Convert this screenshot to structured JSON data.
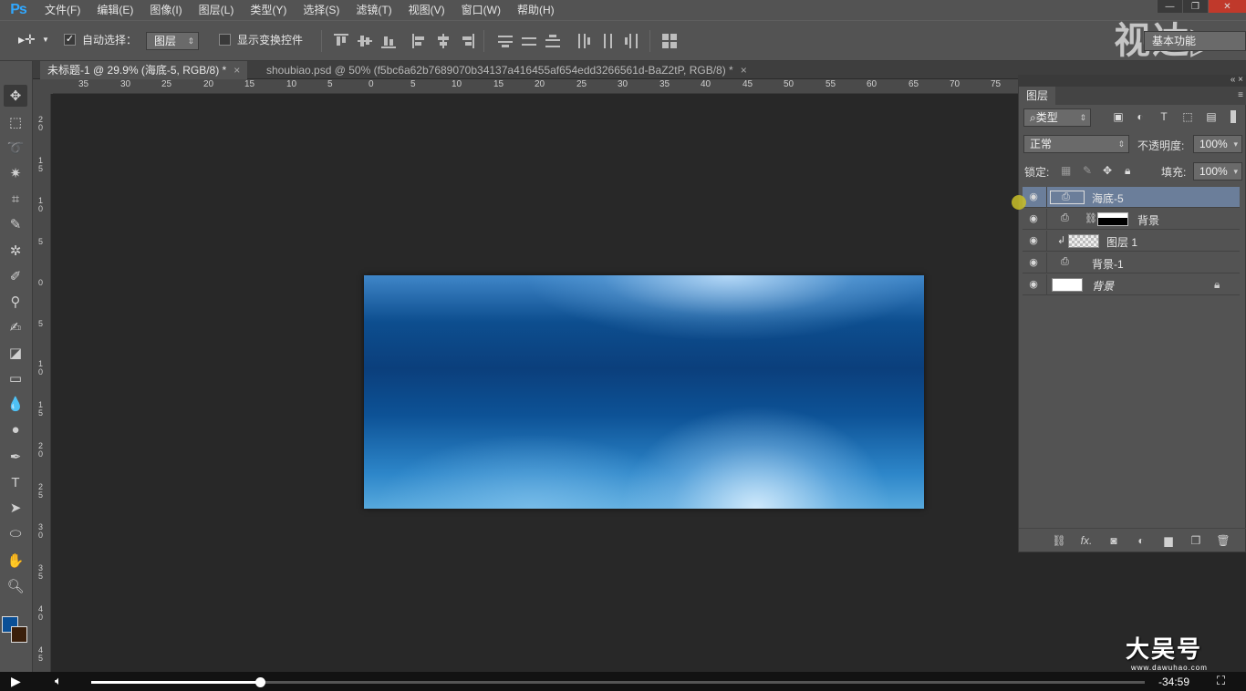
{
  "app": {
    "logo": "Ps"
  },
  "menu": [
    "文件(F)",
    "编辑(E)",
    "图像(I)",
    "图层(L)",
    "类型(Y)",
    "选择(S)",
    "滤镜(T)",
    "视图(V)",
    "窗口(W)",
    "帮助(H)"
  ],
  "window_controls": {
    "minimize": "—",
    "maximize": "❐",
    "close": "✕"
  },
  "options": {
    "move_tool_icon": "move-icon",
    "auto_select_checked": true,
    "auto_select_label": "自动选择：",
    "auto_select_target": "图层",
    "show_transform_checked": false,
    "show_transform_label": "显示变换控件"
  },
  "watermark_text": "视达▷",
  "workspace": "基本功能",
  "tabs": [
    {
      "label": "未标题-1 @ 29.9% (海底-5, RGB/8) *",
      "active": true,
      "close": "×"
    },
    {
      "label": "shoubiao.psd @ 50% (f5bc6a62b7689070b34137a416455af654edd3266561d-BaZ2tP, RGB/8) *",
      "active": false,
      "close": "×"
    }
  ],
  "ruler_h": [
    "35",
    "30",
    "25",
    "20",
    "15",
    "10",
    "5",
    "0",
    "5",
    "10",
    "15",
    "20",
    "25",
    "30",
    "35",
    "40",
    "45",
    "50",
    "55",
    "60",
    "65",
    "70",
    "75"
  ],
  "ruler_v": [
    "20",
    "15",
    "10",
    "5",
    "0",
    "5",
    "10",
    "15",
    "20",
    "25",
    "30",
    "35",
    "40",
    "45"
  ],
  "layers_panel": {
    "tab": "图层",
    "filter_kind": "类型",
    "blend_mode": "正常",
    "opacity_label": "不透明度:",
    "opacity_value": "100%",
    "lock_label": "锁定:",
    "fill_label": "填充:",
    "fill_value": "100%",
    "layers": [
      {
        "name": "海底-5",
        "selected": true,
        "smart": true
      },
      {
        "name": "背景",
        "selected": false,
        "smart": true,
        "mask": true
      },
      {
        "name": "图层 1",
        "selected": false,
        "smart": false,
        "clipped": true
      },
      {
        "name": "背景-1",
        "selected": false,
        "smart": true
      },
      {
        "name": "背景",
        "selected": false,
        "smart": false,
        "locked": true
      }
    ]
  },
  "video": {
    "time_remaining": "-34:59",
    "progress": 0.16
  },
  "brand": {
    "name": "大吴号",
    "url": "www.dawuhao.com"
  },
  "colors": {
    "foreground": "#0a4f96",
    "background": "#3a1f0b",
    "selection": "#6b7e9a"
  }
}
